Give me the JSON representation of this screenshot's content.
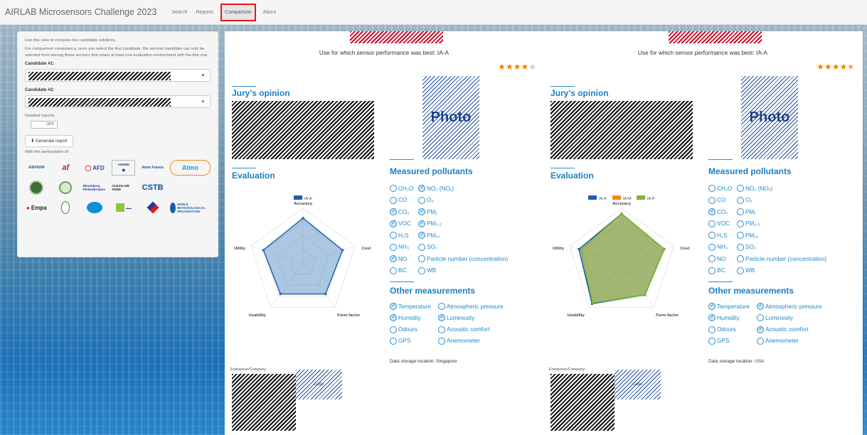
{
  "nav": {
    "brand": "AIRLAB Microsensors Challenge 2023",
    "items": [
      {
        "label": "Search",
        "active": false
      },
      {
        "label": "Reports",
        "active": false
      },
      {
        "label": "Comparison",
        "active": true
      },
      {
        "label": "About",
        "active": false
      }
    ]
  },
  "sidebar": {
    "intro": "Use this view to compare two candidate solutions.",
    "note": "For comparison consistency, once you select the first candidate, the second candidate can only be selected from among those sensors that share at least one evaluation environment with the first one.",
    "candidate1_label": "Candidate #1:",
    "candidate2_label": "Candidate #2:",
    "detailed_label": "Detailed reports:",
    "toggle_state": "OFF",
    "generate_label": "Generate report",
    "participation_label": "With the participation of:",
    "logos": [
      "AIRPARIF",
      "af",
      "AFD",
      "ADEME",
      "Atmo France",
      "Atmo",
      "Bloomberg",
      "Bloomberg Philanthropies",
      "CLEAN AIR FUND",
      "CSTB",
      "",
      "",
      "Empa",
      "",
      "",
      "",
      "",
      "WORLD METEOROLOGICAL ORGANIZATION"
    ]
  },
  "columns": [
    {
      "best_use": "Use for which sensor performance was best: IA-A",
      "rating": 4,
      "rating_max": 5,
      "star_glyphs": [
        "★",
        "★",
        "★",
        "★",
        "★"
      ],
      "jury_title": "Jury's opinion",
      "photo_label": "Photo",
      "evaluation_title": "Evaluation",
      "legend": [
        {
          "name": "IA-A",
          "color": "#1f5fa8"
        }
      ],
      "radar": {
        "axes": [
          "Accuracy",
          "Cost",
          "Form factor",
          "Usability",
          "Utility"
        ],
        "series": [
          {
            "name": "IA-A",
            "values": [
              0.82,
              0.76,
              0.7,
              0.7,
              0.76
            ],
            "stroke": "#2b6cb0",
            "fill": "rgba(70,130,190,0.45)"
          }
        ]
      },
      "pollutants_title": "Measured pollutants",
      "pollutants": [
        [
          {
            "label": "CH₂O",
            "checked": false
          },
          {
            "label": "NO₂ (NOₓ)",
            "checked": true
          }
        ],
        [
          {
            "label": "CO",
            "checked": false
          },
          {
            "label": "O₃",
            "checked": false
          }
        ],
        [
          {
            "label": "CO₂",
            "checked": true
          },
          {
            "label": "PM₁",
            "checked": true
          }
        ],
        [
          {
            "label": "VOC",
            "checked": true
          },
          {
            "label": "PM₂.₅",
            "checked": true
          }
        ],
        [
          {
            "label": "H₂S",
            "checked": false
          },
          {
            "label": "PM₁₀",
            "checked": true
          }
        ],
        [
          {
            "label": "NH₃",
            "checked": false
          },
          {
            "label": "SO₂",
            "checked": false
          }
        ],
        [
          {
            "label": "NO",
            "checked": true
          },
          {
            "label": "Particle number (concentration)",
            "checked": false
          }
        ],
        [
          {
            "label": "BC",
            "checked": false
          },
          {
            "label": "WB",
            "checked": false
          }
        ]
      ],
      "other_title": "Other measurements",
      "other": [
        [
          {
            "label": "Temperature",
            "checked": true
          },
          {
            "label": "Atmospheric pressure",
            "checked": false
          }
        ],
        [
          {
            "label": "Humidity",
            "checked": true
          },
          {
            "label": "Luminosity",
            "checked": true
          }
        ],
        [
          {
            "label": "Odours",
            "checked": false
          },
          {
            "label": "Acoustic comfort",
            "checked": false
          }
        ],
        [
          {
            "label": "GPS",
            "checked": false
          },
          {
            "label": "Anemometer",
            "checked": false
          }
        ]
      ],
      "storage": "Data storage location: Singapore",
      "company_label": "Entreprise/Company",
      "company_logo_text": "Logo"
    },
    {
      "best_use": "Use for which sensor performance was best: IA-A",
      "rating": 4.5,
      "rating_max": 5,
      "star_glyphs": [
        "★",
        "★",
        "★",
        "★",
        "★"
      ],
      "jury_title": "Jury's opinion",
      "photo_label": "Photo",
      "evaluation_title": "Evaluation",
      "legend": [
        {
          "name": "IA-A",
          "color": "#1f5fa8"
        },
        {
          "name": "IA-M",
          "color": "#f08a1c"
        },
        {
          "name": "IA-P",
          "color": "#7db534"
        }
      ],
      "radar": {
        "axes": [
          "Accuracy",
          "Cost",
          "Form factor",
          "Usability",
          "Utility"
        ],
        "series": [
          {
            "name": "IA-A",
            "values": [
              0.9,
              0.82,
              0.72,
              0.92,
              0.82
            ],
            "stroke": "#1f5fa8",
            "fill": "rgba(31,95,168,0.35)"
          },
          {
            "name": "IA-P",
            "values": [
              0.9,
              0.82,
              0.72,
              0.9,
              0.78
            ],
            "stroke": "#7db534",
            "fill": "rgba(153,170,40,0.6)"
          }
        ]
      },
      "pollutants_title": "Measured pollutants",
      "pollutants": [
        [
          {
            "label": "CH₂O",
            "checked": false
          },
          {
            "label": "NO₂ (NOₓ)",
            "checked": false
          }
        ],
        [
          {
            "label": "CO",
            "checked": false
          },
          {
            "label": "O₃",
            "checked": false
          }
        ],
        [
          {
            "label": "CO₂",
            "checked": true
          },
          {
            "label": "PM₁",
            "checked": false
          }
        ],
        [
          {
            "label": "VOC",
            "checked": false
          },
          {
            "label": "PM₂.₅",
            "checked": false
          }
        ],
        [
          {
            "label": "H₂S",
            "checked": false
          },
          {
            "label": "PM₁₀",
            "checked": false
          }
        ],
        [
          {
            "label": "NH₃",
            "checked": false
          },
          {
            "label": "SO₂",
            "checked": false
          }
        ],
        [
          {
            "label": "NO",
            "checked": false
          },
          {
            "label": "Particle number (concentration)",
            "checked": false
          }
        ],
        [
          {
            "label": "BC",
            "checked": false
          },
          {
            "label": "WB",
            "checked": false
          }
        ]
      ],
      "other_title": "Other measurements",
      "other": [
        [
          {
            "label": "Temperature",
            "checked": true
          },
          {
            "label": "Atmospheric pressure",
            "checked": true
          }
        ],
        [
          {
            "label": "Humidity",
            "checked": true
          },
          {
            "label": "Luminosity",
            "checked": false
          }
        ],
        [
          {
            "label": "Odours",
            "checked": false
          },
          {
            "label": "Acoustic comfort",
            "checked": true
          }
        ],
        [
          {
            "label": "GPS",
            "checked": false
          },
          {
            "label": "Anemometer",
            "checked": false
          }
        ]
      ],
      "storage": "Data storage location: USA",
      "company_label": "Entreprise/Company",
      "company_logo_text": "Logo"
    }
  ]
}
